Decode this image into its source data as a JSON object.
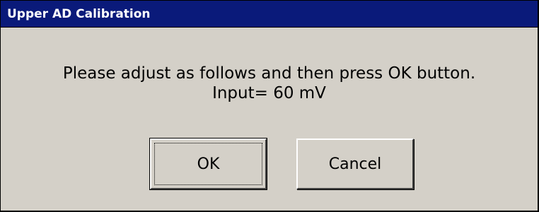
{
  "window": {
    "title": "Upper AD Calibration"
  },
  "message": {
    "line1": "Please adjust as follows and then press OK button.",
    "line2": "Input= 60 mV"
  },
  "buttons": {
    "ok_label": "OK",
    "cancel_label": "Cancel"
  },
  "colors": {
    "titlebar": "#0a1a7a",
    "dialog_background": "#d4d0c8",
    "title_text": "#ffffff"
  }
}
